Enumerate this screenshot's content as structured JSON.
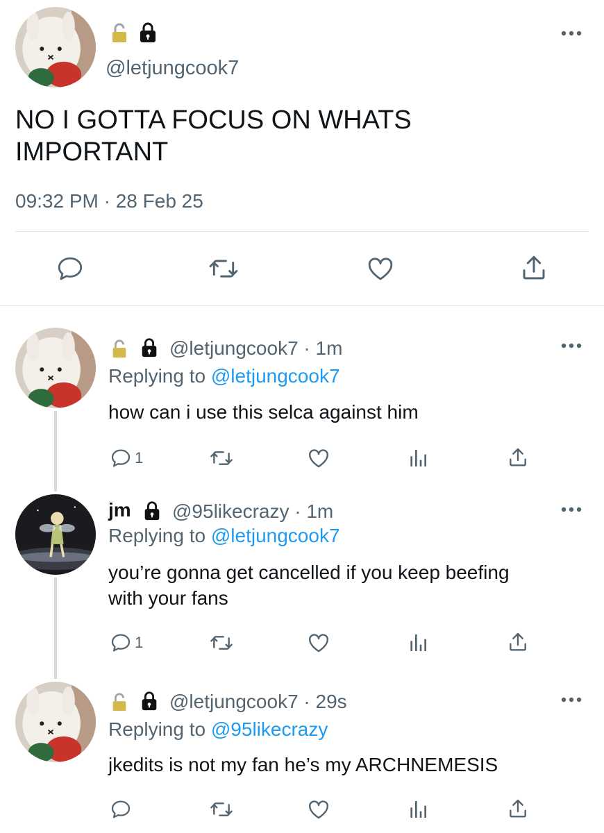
{
  "main_tweet": {
    "handle": "@letjungcook7",
    "text_line1": "NO I GOTTA FOCUS ON WHATS",
    "text_line2": "IMPORTANT",
    "timestamp": "09:32 PM · 28 Feb 25"
  },
  "replies": [
    {
      "name": "",
      "handle_time": "@letjungcook7 · 1m",
      "replying_prefix": "Replying to ",
      "replying_to": "@letjungcook7",
      "text_line1": "how can i use this selca against him",
      "text_line2": "",
      "reply_count": "1"
    },
    {
      "name": "jm",
      "handle_time": "@95likecrazy · 1m",
      "replying_prefix": "Replying to ",
      "replying_to": "@letjungcook7",
      "text_line1": "you’re gonna get cancelled if you keep beefing",
      "text_line2": "with your fans",
      "reply_count": "1"
    },
    {
      "name": "",
      "handle_time": "@letjungcook7 · 29s",
      "replying_prefix": "Replying to ",
      "replying_to": "@95likecrazy",
      "text_line1": "jkedits is not my fan he’s my ARCHNEMESIS",
      "text_line2": "",
      "reply_count": ""
    }
  ],
  "icons": {
    "lock_open": "lock-open-icon",
    "lock_closed": "lock-icon",
    "more": "more-icon",
    "reply": "reply-icon",
    "retweet": "retweet-icon",
    "like": "heart-icon",
    "views": "views-icon",
    "share": "share-icon"
  },
  "colors": {
    "link": "#1d9bf0",
    "muted": "#536471",
    "text": "#0f1419"
  }
}
